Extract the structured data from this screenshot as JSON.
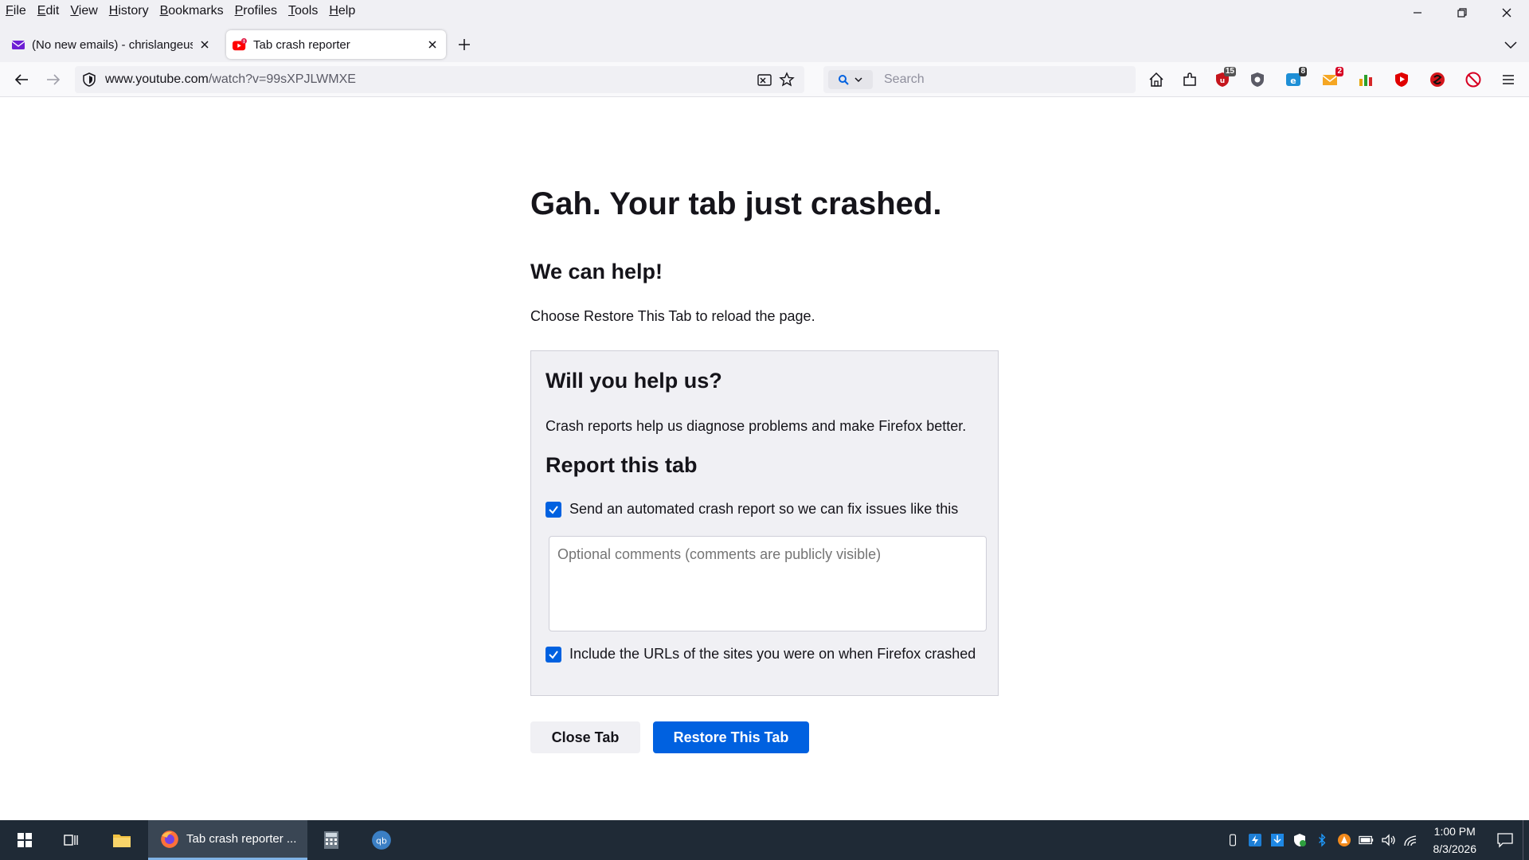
{
  "menubar": {
    "items": [
      {
        "key": "F",
        "rest": "ile"
      },
      {
        "key": "E",
        "rest": "dit"
      },
      {
        "key": "V",
        "rest": "iew"
      },
      {
        "key": "H",
        "rest": "istory"
      },
      {
        "key": "B",
        "rest": "ookmarks"
      },
      {
        "key": "P",
        "rest": "rofiles"
      },
      {
        "key": "T",
        "rest": "ools"
      },
      {
        "key": "H",
        "rest": "elp"
      }
    ]
  },
  "tabs": [
    {
      "title": "(No new emails) - chrislangeusa",
      "active": false,
      "icon": "mail-icon"
    },
    {
      "title": "Tab crash reporter",
      "active": true,
      "icon": "youtube-crash-icon"
    }
  ],
  "navbar": {
    "url_domain": "www.youtube.com",
    "url_path": "/watch?v=99sXPJLWMXE",
    "search_placeholder": "Search",
    "extension_badges": {
      "ublock": "15",
      "ext_blue": "8",
      "ext_orange": "2"
    }
  },
  "content": {
    "title": "Gah. Your tab just crashed.",
    "help_heading": "We can help!",
    "help_text": "Choose Restore This Tab to reload the page.",
    "panel_heading": "Will you help us?",
    "panel_text": "Crash reports help us diagnose problems and make Firefox better.",
    "report_heading": "Report this tab",
    "send_report_label": "Send an automated crash report so we can fix issues like this",
    "send_report_checked": true,
    "comments_placeholder": "Optional comments (comments are publicly visible)",
    "include_urls_label": "Include the URLs of the sites you were on when Firefox crashed",
    "include_urls_checked": true,
    "close_tab_label": "Close Tab",
    "restore_tab_label": "Restore This Tab"
  },
  "taskbar": {
    "firefox_label": "Tab crash reporter ...",
    "time": "1:00 PM",
    "date": "8/3/2026"
  },
  "colors": {
    "accent": "#0061e0",
    "taskbar": "#1f2a36"
  }
}
